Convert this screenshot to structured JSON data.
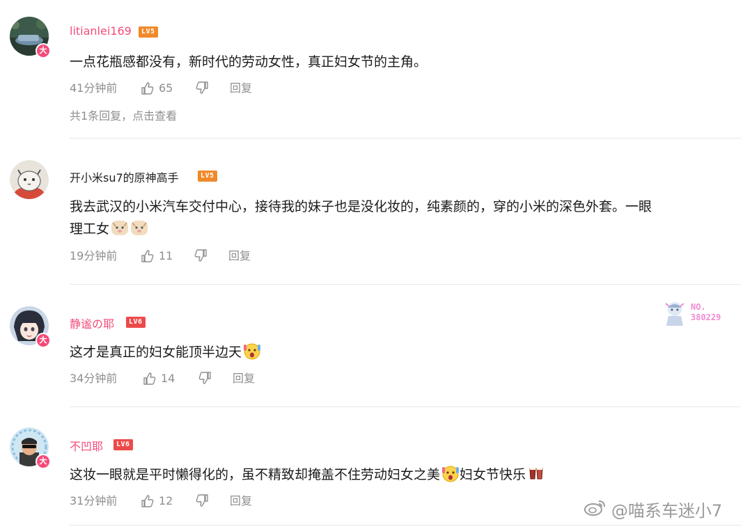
{
  "colors": {
    "username_pink": "#f54b7a",
    "username_default": "#222222",
    "meta_gray": "#8e8e8e",
    "divider": "#e6e6e6"
  },
  "comments": [
    {
      "username": "litianlei169",
      "level": "LV5",
      "vip_badge": "大",
      "content_lines": [
        "一点花瓶感都没有，新时代的劳动女性，真正妇女节的主角。"
      ],
      "time": "41分钟前",
      "likes": "65",
      "reply_label": "回复",
      "replies_text": "共1条回复，点击查看"
    },
    {
      "username": "开小米su7的原神高手",
      "level": "LV5",
      "content_lines": [
        "  我去武汉的小米汽车交付中心，接待我的妹子也是没化妆的，纯素颜的，穿的小米的深色外套。一眼",
        "理工女"
      ],
      "emojis": [
        "doge-emoji",
        "doge-emoji"
      ],
      "time": "19分钟前",
      "likes": "11",
      "reply_label": "回复"
    },
    {
      "username": "静谧の耶",
      "level": "LV6",
      "vip_badge": "大",
      "content_lines": [
        "这才是真正的妇女能顶半边天"
      ],
      "emojis": [
        "shocked-emoji"
      ],
      "time": "34分钟前",
      "likes": "14",
      "reply_label": "回复",
      "fan_card": {
        "label": "NO.",
        "number": "380229"
      }
    },
    {
      "username": "不凹耶",
      "level": "LV6",
      "vip_badge": "大",
      "content_lines": [
        "这妆一眼就是平时懒得化的，虽不精致却掩盖不住劳动妇女之美",
        "妇女节快乐"
      ],
      "emojis": [
        "shocked-emoji",
        "cheers-emoji"
      ],
      "time": "31分钟前",
      "likes": "12",
      "reply_label": "回复"
    }
  ],
  "watermark": "@喵系车迷小7"
}
